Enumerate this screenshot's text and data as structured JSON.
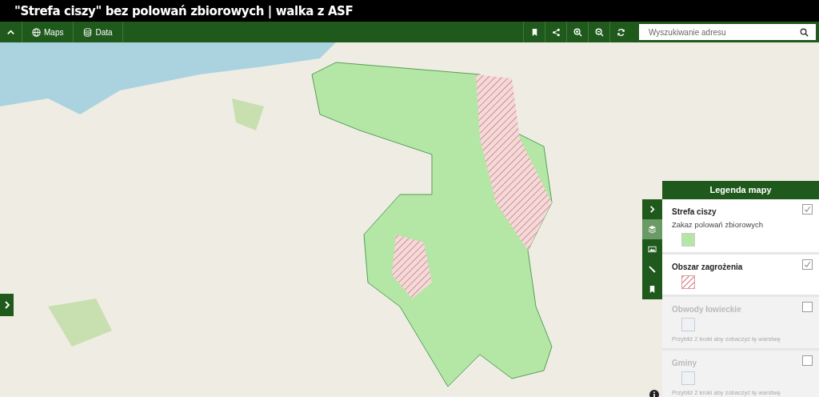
{
  "window": {
    "title": "\"Strefa ciszy\" bez polowań zbiorowych | walka z ASF"
  },
  "toolbar": {
    "menus": [
      {
        "label": "Maps"
      },
      {
        "label": "Data"
      }
    ],
    "search": {
      "placeholder": "Wyszukiwanie adresu"
    }
  },
  "side_tabs": [
    {
      "selected": false
    },
    {
      "selected": true
    },
    {
      "selected": false
    },
    {
      "selected": false
    },
    {
      "selected": false
    }
  ],
  "legend": {
    "title": "Legenda mapy",
    "layers": [
      {
        "title": "Strefa ciszy",
        "description": "Zakaz polowań zbiorowych",
        "kind": "fill",
        "color": "#b4e6a6",
        "checked": true,
        "disabled": false
      },
      {
        "title": "Obszar zagrożenia",
        "kind": "hatch",
        "color": "#e09a9a",
        "checked": true,
        "disabled": false
      },
      {
        "title": "Obwody łowieckie",
        "kind": "fill",
        "color": "#eef1f6",
        "checked": false,
        "disabled": true,
        "hint": "Przybliż 2 kroki aby zobaczyć tę warstwę"
      },
      {
        "title": "Gminy",
        "kind": "fill",
        "color": "#eef1f6",
        "checked": false,
        "disabled": true,
        "hint": "Przybliż 2 kroki aby zobaczyć tę warstwę"
      }
    ]
  }
}
